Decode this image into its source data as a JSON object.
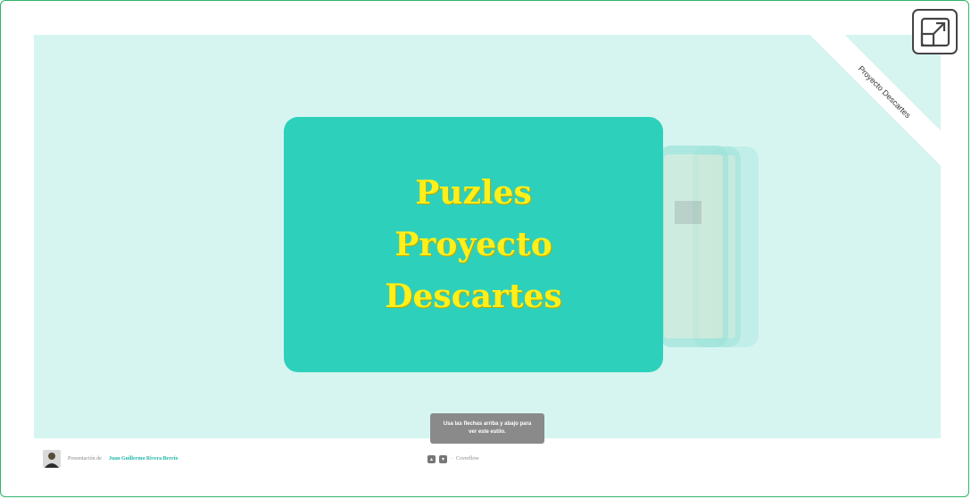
{
  "slide": {
    "title_lines": [
      "Puzles",
      "Proyecto",
      "Descartes"
    ]
  },
  "ribbon": {
    "label": "Proyecto Descartes"
  },
  "tooltip": {
    "text": "Usa las flechas arriba y abajo para ver este estilo."
  },
  "footer": {
    "prefix": "Presentación de",
    "author": "Juan Guillermo Rivera Berrío",
    "nav_separator": "·",
    "style_label": "Coverflow"
  },
  "icons": {
    "expand": "expand-icon",
    "up_arrow": "arrow-up-icon",
    "down_arrow": "arrow-down-icon"
  },
  "colors": {
    "background": "#d6f5f1",
    "slide": "#2dd1bb",
    "title": "#ffef1a",
    "author": "#1fb8a8",
    "frame_border": "#2fb36a"
  }
}
